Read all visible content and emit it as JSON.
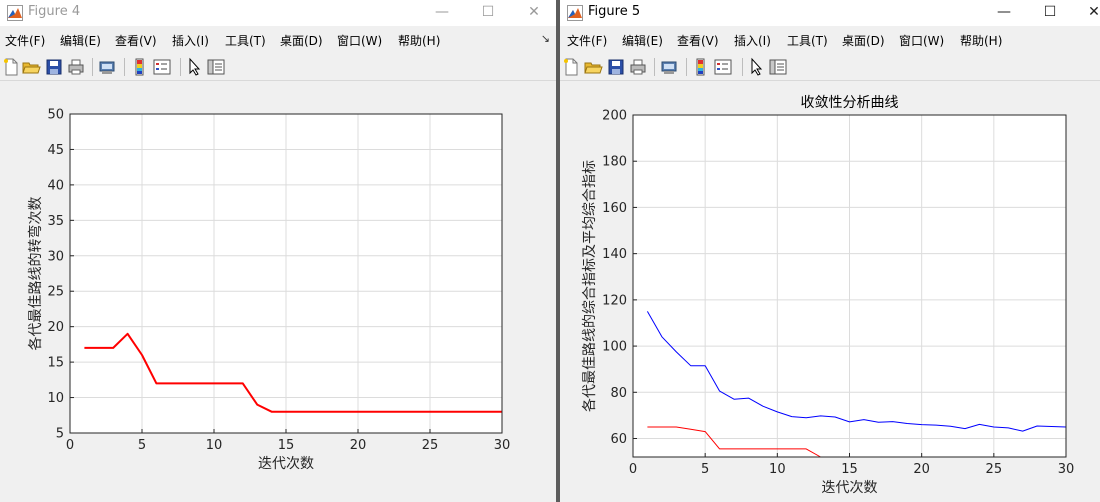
{
  "windows": [
    {
      "id": "fig4",
      "title": "Figure 4",
      "active": false,
      "menu": [
        "文件(F)",
        "编辑(E)",
        "查看(V)",
        "插入(I)",
        "工具(T)",
        "桌面(D)",
        "窗口(W)",
        "帮助(H)"
      ],
      "menu_overflow": "↘",
      "toolbar_icons": [
        "new-figure-icon",
        "open-file-icon",
        "save-icon",
        "print-icon",
        "print-preview-icon",
        "colorbar-icon",
        "legend-icon",
        "pointer-icon",
        "property-editor-icon"
      ]
    },
    {
      "id": "fig5",
      "title": "Figure 5",
      "active": true,
      "menu": [
        "文件(F)",
        "编辑(E)",
        "查看(V)",
        "插入(I)",
        "工具(T)",
        "桌面(D)",
        "窗口(W)",
        "帮助(H)"
      ],
      "toolbar_icons": [
        "new-figure-icon",
        "open-file-icon",
        "save-icon",
        "print-icon",
        "print-preview-icon",
        "colorbar-icon",
        "legend-icon",
        "pointer-icon",
        "property-editor-icon"
      ]
    }
  ],
  "window_controls": {
    "minimize": "—",
    "maximize": "☐",
    "close": "✕"
  },
  "colors": {
    "red": "#ff0000",
    "blue": "#0000ff",
    "grid": "#dcdcdc",
    "axis": "#262626"
  },
  "chart_data": [
    {
      "type": "line",
      "title": "",
      "xlabel": "迭代次数",
      "ylabel": "各代最佳路线的转弯次数",
      "xlim": [
        0,
        30
      ],
      "ylim": [
        5,
        50
      ],
      "xticks": [
        0,
        5,
        10,
        15,
        20,
        25,
        30
      ],
      "yticks": [
        5,
        10,
        15,
        20,
        25,
        30,
        35,
        40,
        45,
        50
      ],
      "grid": true,
      "series": [
        {
          "color": "#ff0000",
          "width": 2,
          "x": [
            1,
            2,
            3,
            4,
            5,
            6,
            7,
            8,
            9,
            10,
            11,
            12,
            13,
            14,
            15,
            16,
            17,
            18,
            19,
            20,
            21,
            22,
            23,
            24,
            25,
            26,
            27,
            28,
            29,
            30
          ],
          "y": [
            17,
            17,
            17,
            19,
            16,
            12,
            12,
            12,
            12,
            12,
            12,
            12,
            9,
            8,
            8,
            8,
            8,
            8,
            8,
            8,
            8,
            8,
            8,
            8,
            8,
            8,
            8,
            8,
            8,
            8
          ]
        }
      ]
    },
    {
      "type": "line",
      "title": "收敛性分析曲线",
      "xlabel": "迭代次数",
      "ylabel": "各代最佳路线的综合指标及平均综合指标",
      "xlim": [
        0,
        30
      ],
      "ylim": [
        52,
        200
      ],
      "xticks": [
        0,
        5,
        10,
        15,
        20,
        25,
        30
      ],
      "yticks": [
        60,
        80,
        100,
        120,
        140,
        160,
        180,
        200
      ],
      "grid": true,
      "series": [
        {
          "color": "#0000ff",
          "width": 1,
          "x": [
            1,
            2,
            3,
            4,
            5,
            6,
            7,
            8,
            9,
            10,
            11,
            12,
            13,
            14,
            15,
            16,
            17,
            18,
            19,
            20,
            21,
            22,
            23,
            24,
            25,
            26,
            27,
            28,
            29,
            30
          ],
          "y": [
            115,
            104,
            97.5,
            91.5,
            91.5,
            80.5,
            77,
            77.5,
            74,
            71.5,
            69.5,
            69,
            69.8,
            69.3,
            67.2,
            68.2,
            67,
            67.3,
            66.5,
            66,
            65.8,
            65.3,
            64.3,
            66.1,
            65,
            64.6,
            63.2,
            65.4,
            65.2,
            65
          ]
        },
        {
          "color": "#ff0000",
          "width": 1,
          "x": [
            1,
            2,
            3,
            4,
            5,
            6,
            7,
            8,
            9,
            10,
            11,
            12,
            13,
            14,
            15,
            16,
            17,
            18,
            19,
            20,
            21,
            22,
            23,
            24,
            25,
            26,
            27,
            28,
            29,
            30
          ],
          "y": [
            65,
            65,
            65,
            64,
            63,
            55.5,
            55.5,
            55.5,
            55.5,
            55.5,
            55.5,
            55.5,
            52,
            52,
            52,
            52,
            52,
            52,
            52,
            52,
            52,
            52,
            52,
            52,
            52,
            52,
            52,
            52,
            52,
            52
          ]
        }
      ]
    }
  ]
}
